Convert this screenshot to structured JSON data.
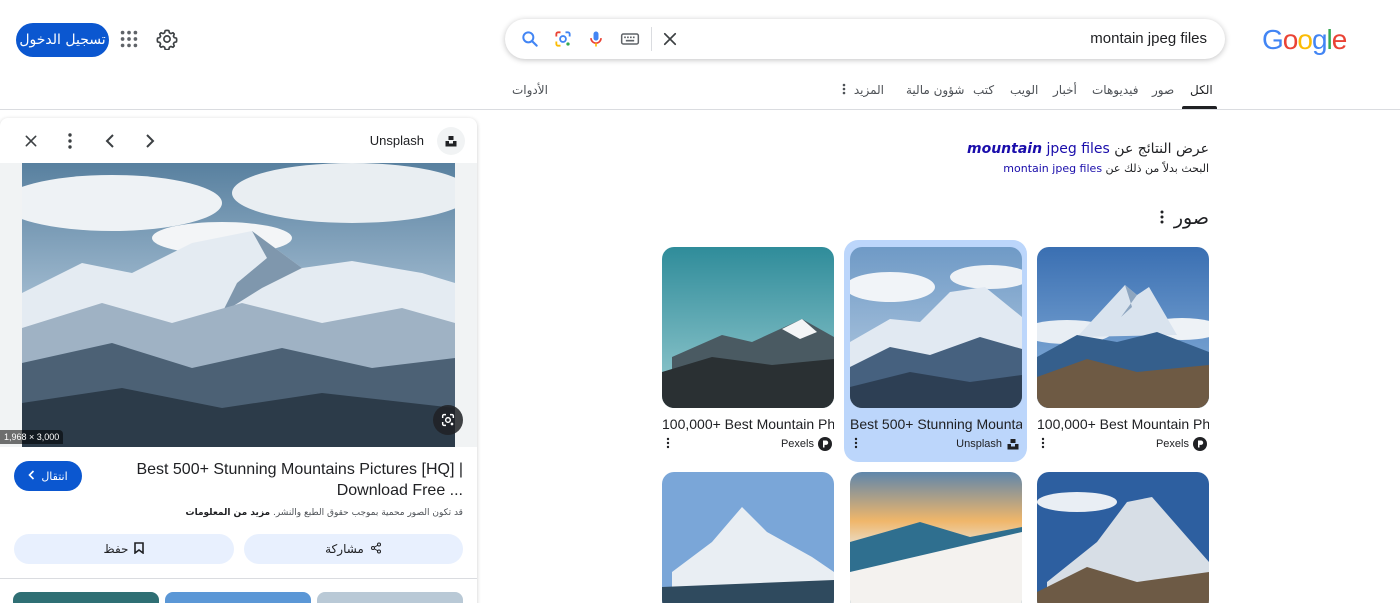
{
  "logo": {
    "letters": [
      "G",
      "o",
      "o",
      "g",
      "l",
      "e"
    ],
    "colors": [
      "#4285F4",
      "#EA4335",
      "#FBBC05",
      "#4285F4",
      "#34A853",
      "#EA4335"
    ]
  },
  "search": {
    "query": "montain jpeg files"
  },
  "header": {
    "signin_label": "تسجيل الدخول"
  },
  "tabs": {
    "all": "الكل",
    "images": "صور",
    "videos": "فيديوهات",
    "news": "أخبار",
    "web": "الويب",
    "books": "كتب",
    "finance": "شؤون مالية",
    "more": "المزيد",
    "tools": "الأدوات"
  },
  "correction": {
    "prefix": "عرض النتائج عن",
    "corrected_bold": "mountain",
    "corrected_rest": "jpeg files",
    "instead_prefix": "البحث بدلاً من ذلك عن",
    "instead_query": "montain jpeg files"
  },
  "images_section": {
    "heading": "صور"
  },
  "results": [
    {
      "title": "100,000+ Best Mountain Ph...",
      "source": "Pexels"
    },
    {
      "title": "Best 500+ Stunning Mounta...",
      "source": "Unsplash"
    },
    {
      "title": "100,000+ Best Mountain Ph...",
      "source": "Pexels"
    }
  ],
  "panel": {
    "source": "Unsplash",
    "dimensions": "1,968 × 3,000",
    "title": "Best 500+ Stunning Mountains Pictures [HQ] | Download Free ...",
    "goto_label": "انتقال",
    "copyright_text": "قد تكون الصور محمية بموجب حقوق الطبع والنشر.",
    "learn_more": "مزيد من المعلومات",
    "share_label": "مشاركة",
    "save_label": "حفظ"
  },
  "colors": {
    "accent": "#0b57d0",
    "link": "#1a0dab",
    "highlight": "#bcd6fb"
  }
}
